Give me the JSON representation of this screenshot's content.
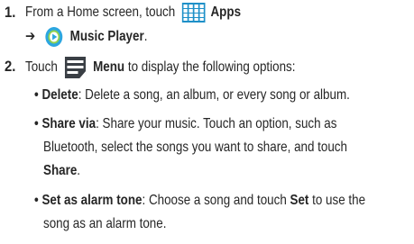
{
  "steps": [
    {
      "number": "1.",
      "line1": {
        "prefix": "From a Home screen, touch",
        "icon": "apps-grid-icon",
        "bold": "Apps"
      },
      "line2": {
        "arrow": "➔",
        "icon": "music-player-icon",
        "bold": "Music Player",
        "suffix": "."
      }
    },
    {
      "number": "2.",
      "line1": {
        "prefix": "Touch",
        "icon": "menu-icon",
        "bold": "Menu",
        "suffix": "to display the following options:"
      }
    }
  ],
  "options": [
    {
      "bullet": "•",
      "term": "Delete",
      "line1": ": Delete a song, an album, or every song or album."
    },
    {
      "bullet": "•",
      "term": "Share via",
      "line1": ": Share your music. Touch an option, such as",
      "line2": "Bluetooth, select the songs you want to share, and touch",
      "line3_bold": "Share",
      "line3_suffix": "."
    },
    {
      "bullet": "•",
      "term": "Set as alarm tone",
      "line1_a": ": Choose a song and touch ",
      "line1_bold": "Set",
      "line1_b": " to use the",
      "line2": "song as an alarm tone."
    }
  ],
  "colors": {
    "apps_icon": "#1e90c8",
    "music_outer": "#2ca6e0",
    "music_inner": "#8fd14f",
    "menu_icon": "#3a3f45",
    "text": "#262626"
  }
}
